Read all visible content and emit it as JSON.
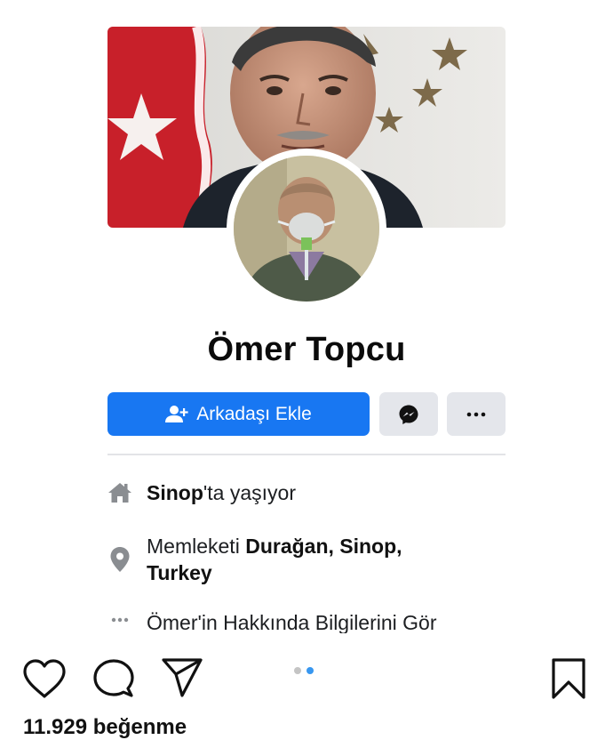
{
  "profile": {
    "name": "Ömer Topcu",
    "add_friend_label": "Arkadaşı Ekle",
    "messenger_icon": "messenger-icon",
    "more_icon": "more-dots-icon"
  },
  "intro": {
    "lives_city": "Sinop",
    "lives_suffix": "'ta yaşıyor",
    "hometown_prefix": "Memleketi ",
    "hometown_place_line1": "Durağan, Sinop,",
    "hometown_place_line2": "Turkey",
    "about_link": "Ömer'in Hakkında Bilgilerini Gör"
  },
  "instagram": {
    "icons": [
      "heart-icon",
      "comment-icon",
      "share-icon",
      "bookmark-icon"
    ],
    "carousel": {
      "count": 2,
      "active_index": 1
    },
    "likes_text": "11.929 beğenme"
  },
  "colors": {
    "facebook_blue": "#1877f2",
    "secondary_button": "#e4e6eb",
    "carousel_active": "#3897f0"
  }
}
